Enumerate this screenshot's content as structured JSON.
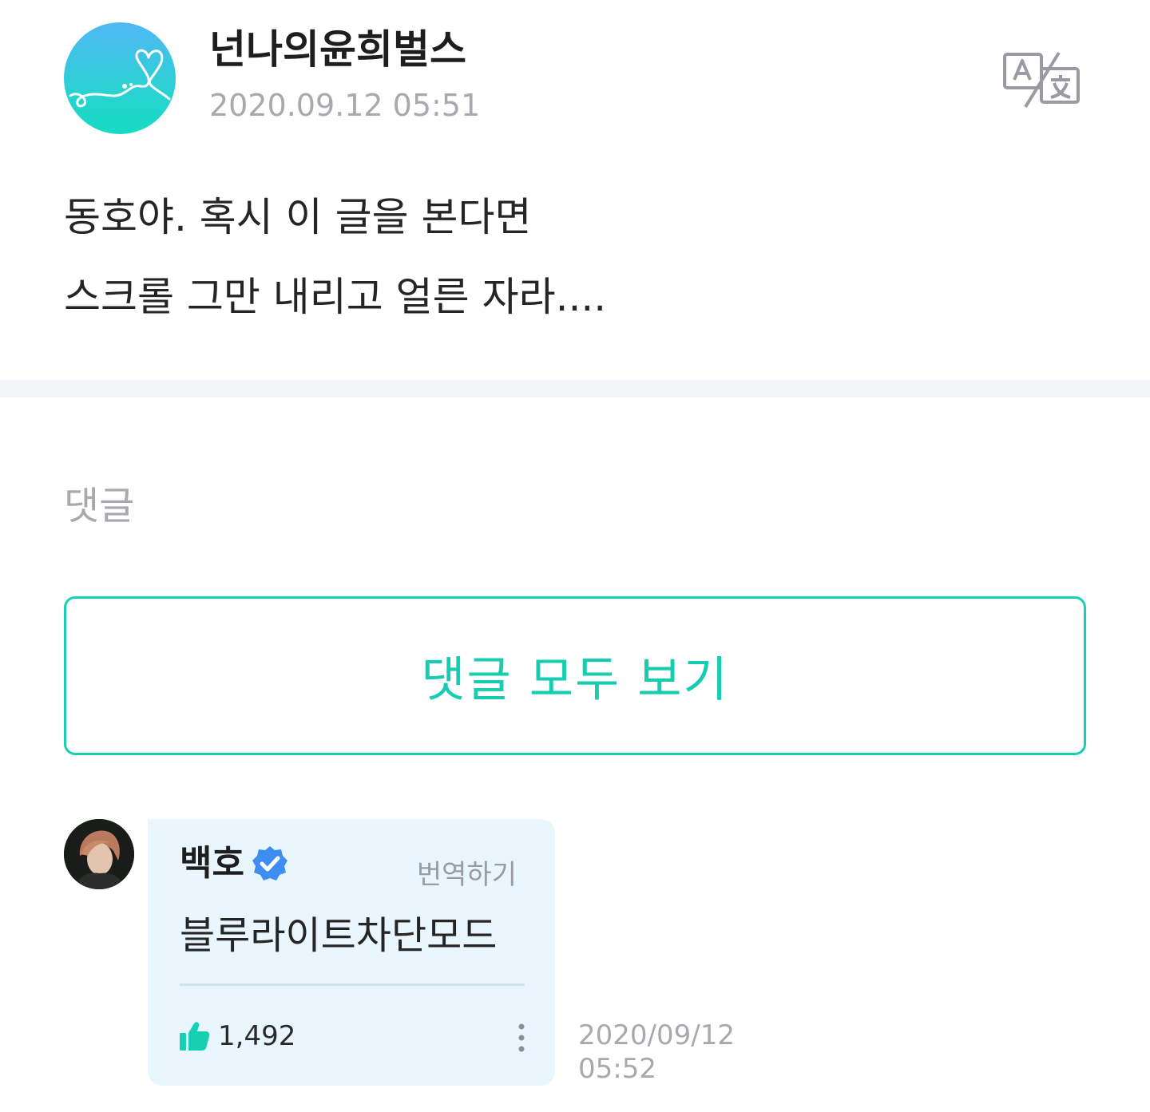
{
  "post": {
    "author": "넌나의윤희벌스",
    "time": "2020.09.12 05:51",
    "translate_icon": "translate-icon",
    "lines": [
      "동호야. 혹시 이 글을 본다면",
      "스크롤 그만 내리고 얼른 자라...."
    ]
  },
  "comments_section": {
    "label": "댓글",
    "view_all": "댓글 모두 보기"
  },
  "comment": {
    "author": "백호",
    "verified_icon": "verified-badge-icon",
    "translate": "번역하기",
    "text": "블루라이트차단모드",
    "likes": "1,492",
    "date": "2020/09/12",
    "time": "05:52"
  },
  "colors": {
    "accent": "#17d0b4",
    "bubble": "#eaf6fe",
    "muted_text": "#a8a8ae",
    "verified": "#3d8ef0"
  }
}
